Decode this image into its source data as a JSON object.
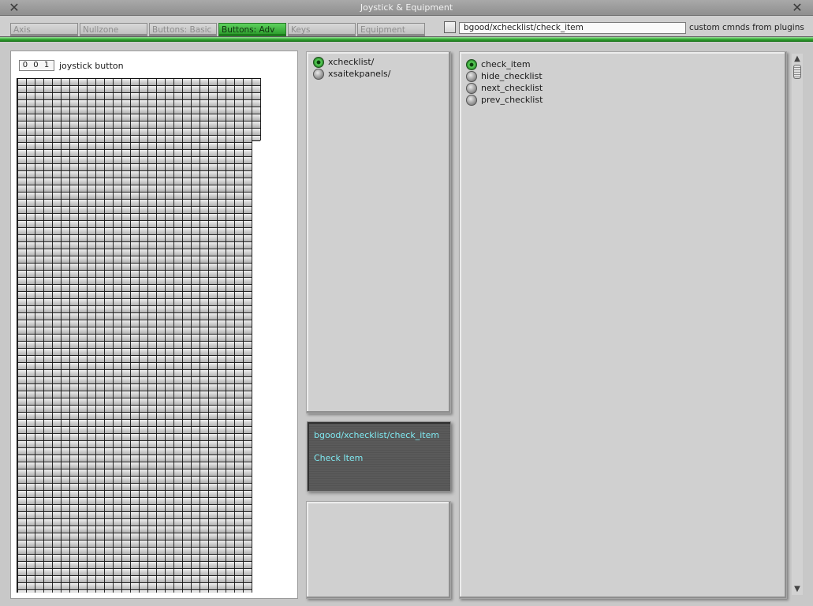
{
  "window": {
    "title": "Joystick & Equipment",
    "close_left": "✕",
    "close_right": "✕"
  },
  "tabs": [
    {
      "label": "Axis",
      "active": false
    },
    {
      "label": "Nullzone",
      "active": false
    },
    {
      "label": "Buttons: Basic",
      "active": false
    },
    {
      "label": "Buttons: Adv",
      "active": true
    },
    {
      "label": "Keys",
      "active": false
    },
    {
      "label": "Equipment",
      "active": false
    }
  ],
  "command_search": {
    "value": "bgood/xchecklist/check_item",
    "checkbox_label": "custom cmnds from plugins",
    "checked": false
  },
  "joystick": {
    "button_number": "0 0 1",
    "button_label": "joystick button"
  },
  "folders": [
    {
      "label": "xchecklist/",
      "selected": true
    },
    {
      "label": "xsaitekpanels/",
      "selected": false
    }
  ],
  "commands": [
    {
      "label": "check_item",
      "selected": true
    },
    {
      "label": "hide_checklist",
      "selected": false
    },
    {
      "label": "next_checklist",
      "selected": false
    },
    {
      "label": "prev_checklist",
      "selected": false
    }
  ],
  "info": {
    "command": "bgood/xchecklist/check_item",
    "description": "Check Item"
  },
  "scrollbar": {
    "up": "▲",
    "down": "▼"
  },
  "colors": {
    "accent_green": "#2fa02f",
    "info_text": "#7fe8f0",
    "panel_gray": "#d0d0d0"
  }
}
